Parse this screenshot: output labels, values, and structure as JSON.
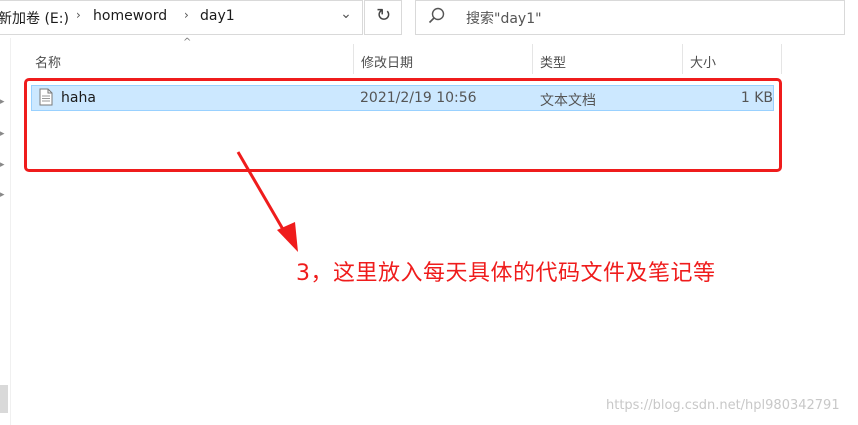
{
  "address_bar": {
    "crumbs": [
      "新加卷 (E:)",
      "homeword",
      "day1"
    ],
    "separator": "›",
    "dropdown_glyph": "⌄"
  },
  "refresh": {
    "icon": "refresh-icon",
    "glyph": "↻"
  },
  "search": {
    "placeholder": "搜索\"day1\"",
    "icon": "search-icon"
  },
  "columns": {
    "name": "名称",
    "modified": "修改日期",
    "type": "类型",
    "size": "大小",
    "sort_caret": "^"
  },
  "files": [
    {
      "name": "haha",
      "modified": "2021/2/19 10:56",
      "type": "文本文档",
      "size": "1 KB",
      "icon": "text-file-icon"
    }
  ],
  "annotation": {
    "text": "3，这里放入每天具体的代码文件及笔记等",
    "color": "#ef1c1c"
  },
  "watermark": "https://blog.csdn.net/hpl980342791",
  "colors": {
    "selection_bg": "#cce8ff",
    "selection_border": "#99d1ff",
    "annotation_red": "#ef1c1c"
  }
}
